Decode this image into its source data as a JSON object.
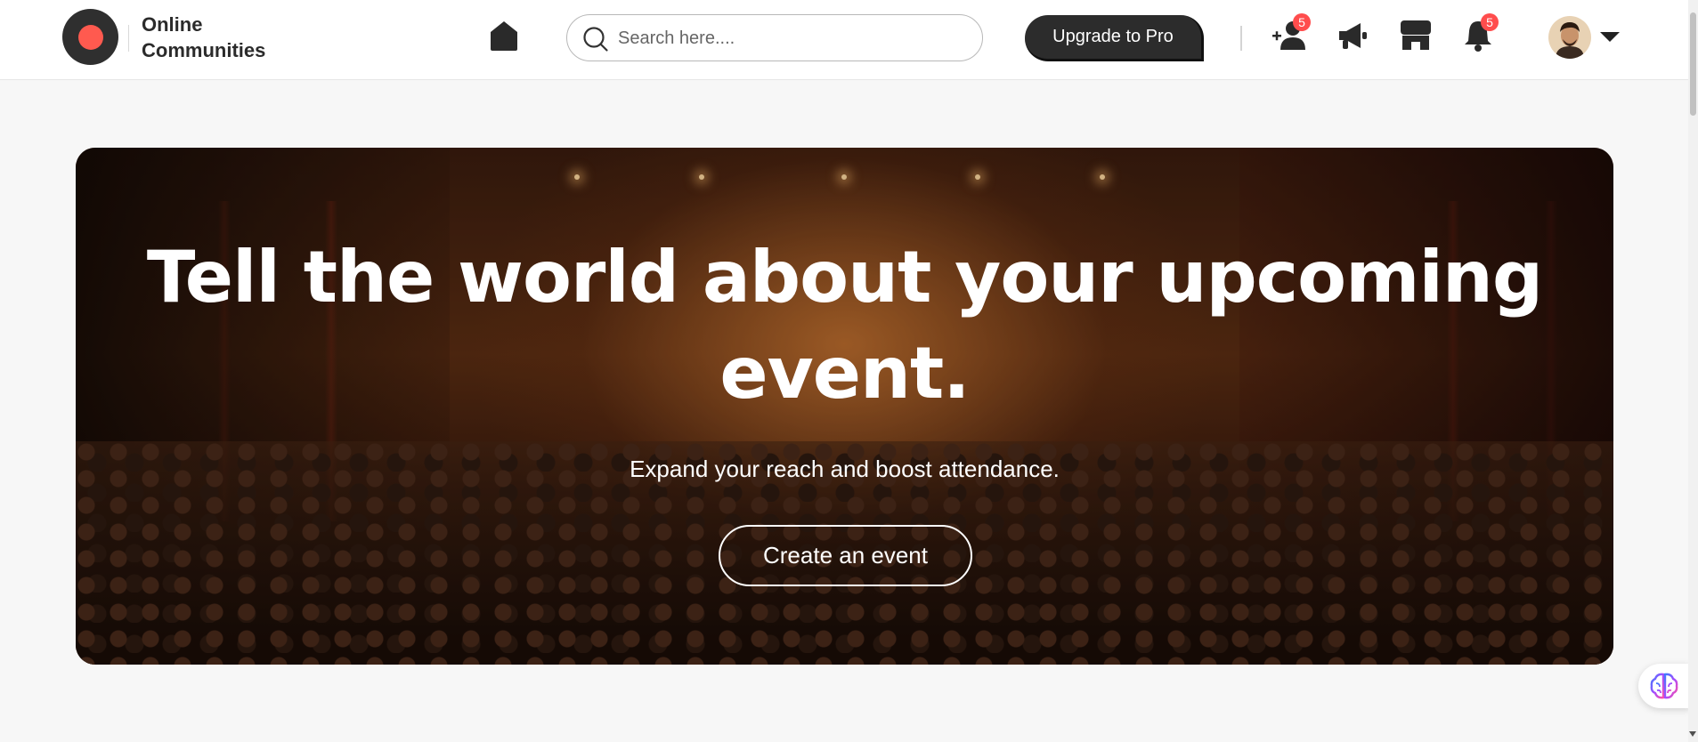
{
  "header": {
    "brand_line1": "Online",
    "brand_line2": "Communities",
    "search_placeholder": "Search here....",
    "upgrade_label": "Upgrade to Pro",
    "friend_requests_count": "5",
    "notifications_count": "5"
  },
  "hero": {
    "title": "Tell the world about your upcoming event.",
    "subtitle": "Expand your reach and boost attendance.",
    "cta_label": "Create an event"
  },
  "icons": {
    "logo": "logo-icon",
    "home": "home-icon",
    "search": "search-icon",
    "friend_requests": "add-user-icon",
    "announcements": "megaphone-icon",
    "marketplace": "store-icon",
    "notifications": "bell-icon",
    "profile_menu": "chevron-down-icon",
    "ai_assistant": "brain-icon"
  },
  "colors": {
    "brand_dark": "#2f2f2f",
    "brand_accent": "#ff5a4f",
    "badge": "#ff4d4d",
    "upgrade_bg": "#2c2c2c"
  }
}
